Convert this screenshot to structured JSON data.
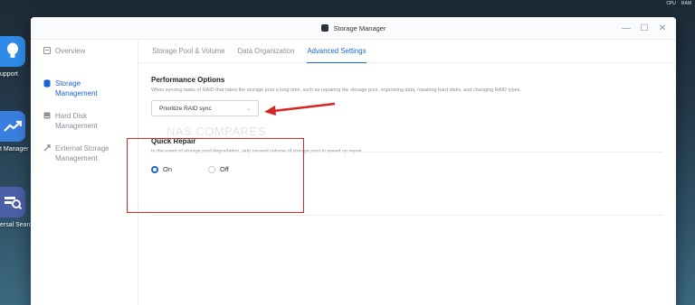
{
  "system_tray": [
    "CPU",
    "RAM"
  ],
  "desktop_icons": [
    {
      "label": "upport",
      "color": "#2f8be8",
      "icon": "lightbulb-icon"
    },
    {
      "label": "t Manager",
      "color": "#3a7fe0",
      "icon": "chart-icon"
    },
    {
      "label": "ersal Searc",
      "color": "#4b5ea8",
      "icon": "search-icon"
    }
  ],
  "window": {
    "title": "Storage Manager"
  },
  "sidebar": {
    "items": [
      {
        "label": "Overview",
        "icon": "overview-icon"
      },
      {
        "label": "Storage\nManagement",
        "icon": "storage-icon"
      },
      {
        "label": "Hard Disk\nManagement",
        "icon": "disk-icon"
      },
      {
        "label": "External Storage\nManagement",
        "icon": "external-icon"
      }
    ]
  },
  "tabs": [
    "Storage Pool & Volume",
    "Data Organization",
    "Advanced Settings"
  ],
  "performance": {
    "title": "Performance Options",
    "description": "When syncing tasks of RAID that takes the storage pool a long time, such as repairing the storage pool, organizing data, repairing hard disks, and changing RAID types.",
    "selected": "Prioritize RAID sync"
  },
  "quick_repair": {
    "title": "Quick Repair",
    "description": "In the event of storage pool degradation, skip unused volume of storage pool to speed up repair.",
    "on_label": "On",
    "off_label": "Off",
    "value": "On"
  },
  "watermark": "NAS COMPARES",
  "colors": {
    "accent": "#1a66d4",
    "annotation": "#d62525"
  }
}
